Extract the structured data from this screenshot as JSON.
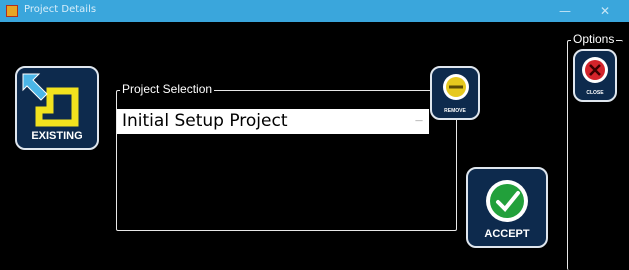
{
  "window": {
    "title": "Project Details",
    "minimize_icon": "minimize-icon",
    "close_icon": "close-window-icon"
  },
  "project_selection": {
    "legend": "Project Selection",
    "items": [
      "Initial Setup Project"
    ],
    "selected": "Initial Setup Project"
  },
  "buttons": {
    "existing": "EXISTING",
    "remove": "REMOVE",
    "accept": "ACCEPT",
    "close": "CLOSE"
  },
  "options": {
    "legend": "Options"
  },
  "colors": {
    "titlebar": "#3aa6dc",
    "button_fill": "#0d2a4d",
    "accept_green": "#22a03b",
    "close_red": "#d3242b",
    "remove_yellow": "#e6c81e"
  }
}
